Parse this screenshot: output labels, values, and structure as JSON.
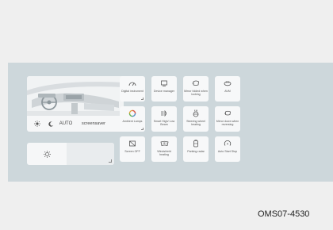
{
  "quick_settings": {
    "auto_label": "AUTO",
    "screensaver_label": "screensaver"
  },
  "tiles": [
    {
      "id": "digital-instrument",
      "label": "Digital instrument",
      "icon": "gauge-icon"
    },
    {
      "id": "device-manager",
      "label": "Device manager",
      "icon": "device-icon"
    },
    {
      "id": "mirror-folded",
      "label": "Mirror folded when locking",
      "icon": "mirror-icon"
    },
    {
      "id": "avm",
      "label": "AVM",
      "icon": "camera-360-icon"
    },
    {
      "id": "ambient-lamps",
      "label": "Ambient Lamps",
      "icon": "ring-icon"
    },
    {
      "id": "smart-high-low-beam",
      "label": "Smart High/ Low Beam",
      "icon": "headlight-icon"
    },
    {
      "id": "steering-wheel-heating",
      "label": "Steering wheel heating",
      "icon": "steering-heat-icon"
    },
    {
      "id": "mirror-down-reversing",
      "label": "Mirror down when reversing",
      "icon": "mirror-down-icon"
    },
    {
      "id": "screen-off",
      "label": "Screen OFF",
      "icon": "screen-off-icon"
    },
    {
      "id": "windshield-heating",
      "label": "Windshield heating",
      "icon": "windshield-icon"
    },
    {
      "id": "parking-radar",
      "label": "Parking radar",
      "icon": "radar-icon"
    },
    {
      "id": "auto-start-stop",
      "label": "Auto Start Stop",
      "icon": "auto-stop-icon"
    }
  ],
  "footer": {
    "reference_code": "OMS07-4530"
  }
}
